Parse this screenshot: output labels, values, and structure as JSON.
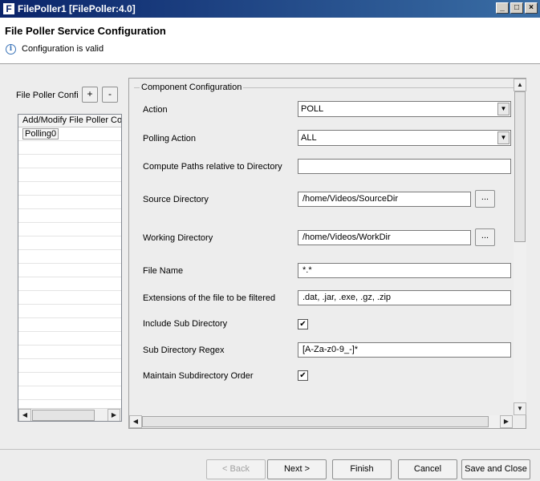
{
  "window": {
    "title": "FilePoller1 [FilePoller:4.0]",
    "controls": {
      "minimize": "_",
      "maximize": "□",
      "close": "×"
    }
  },
  "header": {
    "title": "File Poller Service Configuration",
    "status": "Configuration is valid"
  },
  "left_panel": {
    "label": "File Poller Confi",
    "add_label": "+",
    "remove_label": "-",
    "column_header": "Add/Modify File Poller Cor",
    "rows": [
      "Polling0"
    ]
  },
  "config": {
    "group_title": "Component Configuration",
    "action": {
      "label": "Action",
      "value": "POLL"
    },
    "polling_action": {
      "label": "Polling Action",
      "value": "ALL"
    },
    "compute_paths": {
      "label": "Compute Paths relative to Directory",
      "value": ""
    },
    "source_directory": {
      "label": "Source Directory",
      "value": "/home/Videos/SourceDir",
      "browse_label": "..."
    },
    "working_directory": {
      "label": "Working Directory",
      "value": "/home/Videos/WorkDir",
      "browse_label": "..."
    },
    "file_name": {
      "label": "File Name",
      "value": "*.*"
    },
    "extensions": {
      "label": "Extensions of the file to be filtered",
      "value": ".dat, .jar, .exe, .gz, .zip"
    },
    "include_sub_directory": {
      "label": "Include Sub Directory",
      "checked": true
    },
    "sub_directory_regex": {
      "label": "Sub Directory Regex",
      "value": "[A-Za-z0-9_-]*"
    },
    "maintain_subdirectory_order": {
      "label": "Maintain Subdirectory Order",
      "checked": true
    }
  },
  "footer": {
    "back_label": "< Back",
    "next_label": "Next >",
    "finish_label": "Finish",
    "cancel_label": "Cancel",
    "save_close_label": "Save and Close"
  },
  "icons": {
    "info": "info-icon",
    "dropdown_arrow": "chevron-down-icon",
    "checkmark": "checkmark-icon"
  },
  "colors": {
    "title_bar": "#0a246a",
    "info_icon": "#3a73b8"
  }
}
